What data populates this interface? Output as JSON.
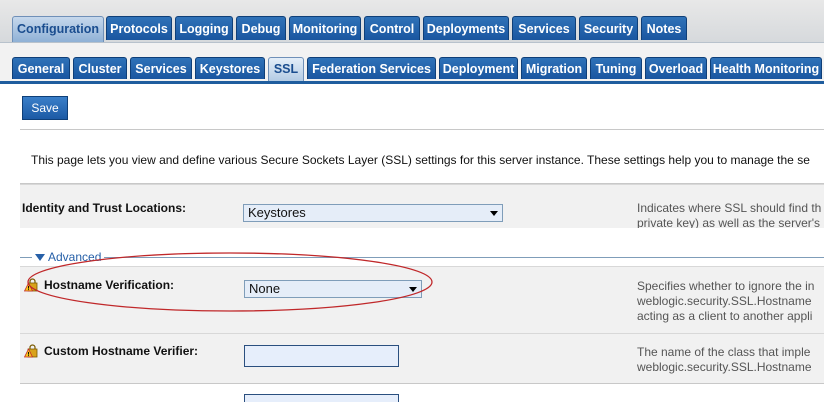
{
  "top_tabs": [
    {
      "label": "Configuration",
      "active": true
    },
    {
      "label": "Protocols",
      "active": false
    },
    {
      "label": "Logging",
      "active": false
    },
    {
      "label": "Debug",
      "active": false
    },
    {
      "label": "Monitoring",
      "active": false
    },
    {
      "label": "Control",
      "active": false
    },
    {
      "label": "Deployments",
      "active": false
    },
    {
      "label": "Services",
      "active": false
    },
    {
      "label": "Security",
      "active": false
    },
    {
      "label": "Notes",
      "active": false
    }
  ],
  "sub_tabs": [
    {
      "label": "General",
      "active": false
    },
    {
      "label": "Cluster",
      "active": false
    },
    {
      "label": "Services",
      "active": false
    },
    {
      "label": "Keystores",
      "active": false
    },
    {
      "label": "SSL",
      "active": true
    },
    {
      "label": "Federation Services",
      "active": false
    },
    {
      "label": "Deployment",
      "active": false
    },
    {
      "label": "Migration",
      "active": false
    },
    {
      "label": "Tuning",
      "active": false
    },
    {
      "label": "Overload",
      "active": false
    },
    {
      "label": "Health Monitoring",
      "active": false
    }
  ],
  "toolbar": {
    "save_label": "Save"
  },
  "intro_text": "This page lets you view and define various Secure Sockets Layer (SSL) settings for this server instance. These settings help you to manage the se",
  "identity": {
    "label": "Identity and Trust Locations:",
    "value": "Keystores",
    "desc_line1": "Indicates where SSL should find th",
    "desc_line2": "private key) as well as the server's"
  },
  "advanced": {
    "label": "Advanced"
  },
  "hostname_verification": {
    "label": "Hostname Verification:",
    "value": "None",
    "desc_line1": "Specifies whether to ignore the in",
    "desc_line2": "weblogic.security.SSL.Hostname",
    "desc_line3": "acting as a client to another appli"
  },
  "custom_verifier": {
    "label": "Custom Hostname Verifier:",
    "value": "",
    "desc_line1": "The name of the class that imple",
    "desc_line2": "weblogic.security.SSL.Hostname"
  },
  "colors": {
    "tab_blue": "#1a56a0",
    "highlight_ellipse": "#c0282a",
    "link_blue": "#2760a8"
  },
  "icons": {
    "field_icon": "warning-lock-icon",
    "advanced_toggle": "triangle-down-icon",
    "dropdown": "dropdown-arrow-icon"
  }
}
